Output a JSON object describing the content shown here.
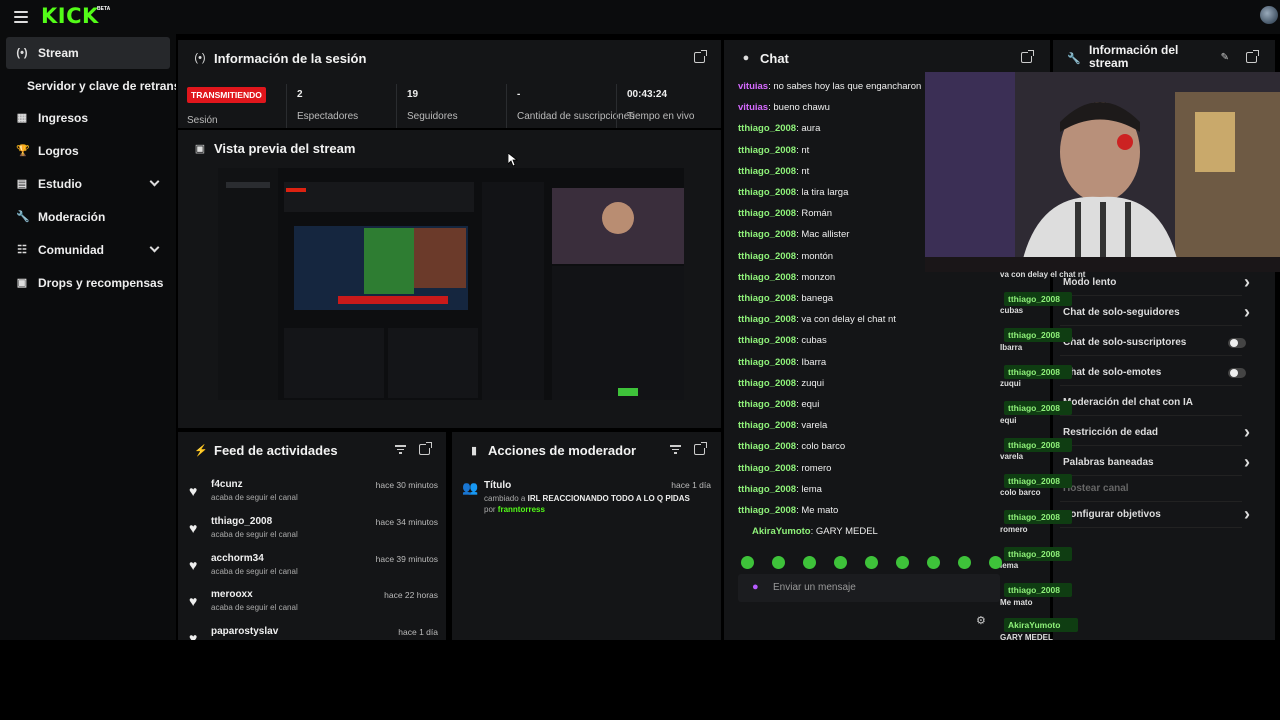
{
  "app": {
    "logo": "KICK",
    "logo_badge": "BETA"
  },
  "sidebar": {
    "items": [
      {
        "label": "Stream",
        "icon": "broadcast-icon",
        "active": true
      },
      {
        "label": "Servidor y clave de retransmisión",
        "icon": "none"
      },
      {
        "label": "Ingresos",
        "icon": "bars-icon"
      },
      {
        "label": "Logros",
        "icon": "trophy-icon"
      },
      {
        "label": "Estudio",
        "icon": "studio-icon",
        "expandable": true
      },
      {
        "label": "Moderación",
        "icon": "wrench-icon"
      },
      {
        "label": "Comunidad",
        "icon": "community-icon",
        "expandable": true
      },
      {
        "label": "Drops y recompensas",
        "icon": "drops-icon"
      }
    ]
  },
  "session": {
    "title": "Información de la sesión",
    "live_badge": "TRANSMITIENDO",
    "session_label": "Sesión",
    "stats": [
      {
        "value": "2",
        "label": "Espectadores"
      },
      {
        "value": "19",
        "label": "Seguidores"
      },
      {
        "value": "-",
        "label": "Cantidad de suscripciones"
      },
      {
        "value": "00:43:24",
        "label": "Tiempo en vivo"
      }
    ]
  },
  "preview": {
    "title": "Vista previa del stream"
  },
  "feed": {
    "title": "Feed de actividades",
    "items": [
      {
        "user": "f4cunz",
        "text": "acaba de seguir el canal",
        "time": "hace 30 minutos"
      },
      {
        "user": "tthiago_2008",
        "text": "acaba de seguir el canal",
        "time": "hace 34 minutos"
      },
      {
        "user": "acchorm34",
        "text": "acaba de seguir el canal",
        "time": "hace 39 minutos"
      },
      {
        "user": "merooxx",
        "text": "acaba de seguir el canal",
        "time": "hace 22 horas"
      },
      {
        "user": "paparostyslav",
        "text": "",
        "time": "hace 1 día"
      }
    ]
  },
  "mod_actions": {
    "title": "Acciones de moderador",
    "items": [
      {
        "action": "Título",
        "time": "hace 1 día",
        "desc_prefix": "cambiado a",
        "desc_value": "IRL REACCIONANDO TODO A LO Q PIDAS",
        "by_prefix": "por",
        "by_user": "franntorress"
      }
    ]
  },
  "chat": {
    "title": "Chat",
    "input_placeholder": "Enviar un mensaje",
    "colors": {
      "pink": "#d66bff",
      "green": "#8ff27a",
      "blue": "#6fb7ff"
    },
    "messages": [
      {
        "user": "vituias",
        "text": "no sabes hoy las que engancharon",
        "color": "#d66bff"
      },
      {
        "user": "vituias",
        "text": "bueno chawu",
        "color": "#d66bff"
      },
      {
        "user": "tthiago_2008",
        "text": "aura",
        "color": "#8ff27a"
      },
      {
        "user": "tthiago_2008",
        "text": "nt",
        "color": "#8ff27a"
      },
      {
        "user": "tthiago_2008",
        "text": "nt",
        "color": "#8ff27a"
      },
      {
        "user": "tthiago_2008",
        "text": "la tira larga",
        "color": "#8ff27a"
      },
      {
        "user": "tthiago_2008",
        "text": "Román",
        "color": "#8ff27a"
      },
      {
        "user": "tthiago_2008",
        "text": "Mac allister",
        "color": "#8ff27a"
      },
      {
        "user": "tthiago_2008",
        "text": "montón",
        "color": "#8ff27a"
      },
      {
        "user": "tthiago_2008",
        "text": "monzon",
        "color": "#8ff27a"
      },
      {
        "user": "tthiago_2008",
        "text": "banega",
        "color": "#8ff27a"
      },
      {
        "user": "tthiago_2008",
        "text": "va con delay el chat nt",
        "color": "#8ff27a"
      },
      {
        "user": "tthiago_2008",
        "text": "cubas",
        "color": "#8ff27a"
      },
      {
        "user": "tthiago_2008",
        "text": "Ibarra",
        "color": "#8ff27a"
      },
      {
        "user": "tthiago_2008",
        "text": "zuqui",
        "color": "#8ff27a"
      },
      {
        "user": "tthiago_2008",
        "text": "equi",
        "color": "#8ff27a"
      },
      {
        "user": "tthiago_2008",
        "text": "varela",
        "color": "#8ff27a"
      },
      {
        "user": "tthiago_2008",
        "text": "colo barco",
        "color": "#8ff27a"
      },
      {
        "user": "tthiago_2008",
        "text": "romero",
        "color": "#8ff27a"
      },
      {
        "user": "tthiago_2008",
        "text": "lema",
        "color": "#8ff27a"
      },
      {
        "user": "tthiago_2008",
        "text": "Me mato",
        "color": "#8ff27a"
      },
      {
        "user": "AkiraYumoto",
        "text": "GARY MEDEL",
        "color": "#8ff27a"
      }
    ]
  },
  "stream_info": {
    "title": "Información del stream",
    "settings": [
      "Modo lento",
      "Chat de solo-seguidores",
      "Chat de solo-suscriptores",
      "Chat de solo-emotes",
      "Moderación del chat con IA",
      "Restricción de edad",
      "Palabras baneadas",
      "Hostear canal",
      "Configurar objetivos"
    ]
  },
  "overlay_chat": {
    "tags": [
      "tthiago_2008",
      "tthiago_2008",
      "tthiago_2008",
      "tthiago_2008",
      "tthiago_2008",
      "tthiago_2008",
      "tthiago_2008",
      "tthiago_2008",
      "tthiago_2008"
    ],
    "msgs": [
      "va con delay el chat nt",
      "cubas",
      "Ibarra",
      "zuqui",
      "equi",
      "varela",
      "colo barco",
      "romero",
      "lema",
      "Me mato"
    ],
    "last_user": "AkiraYumoto",
    "last_msg": "GARY MEDEL"
  }
}
